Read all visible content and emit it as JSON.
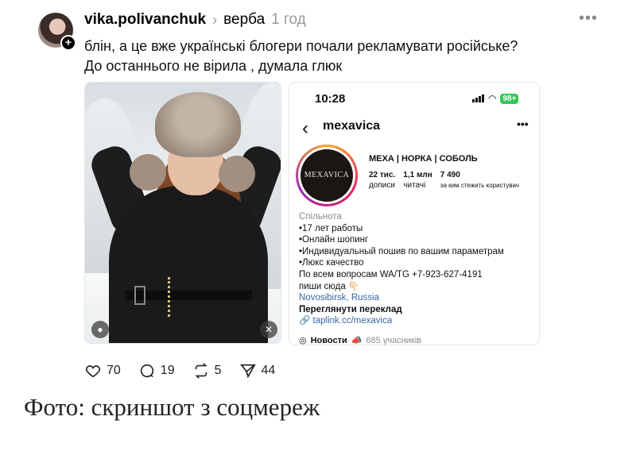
{
  "post": {
    "username": "vika.polivanchuk",
    "topic": "верба",
    "time": "1 год",
    "caption_line1": "блін, а це вже українські блогери почали рекламувати російське?",
    "caption_line2": "До останнього не вірила , думала глюк"
  },
  "screenshot": {
    "status_time": "10:28",
    "battery": "98+",
    "handle": "mexavica",
    "logo_text": "MEXAVICA",
    "profile_name": "МЕХА | НОРКА | СОБОЛЬ",
    "stats": [
      {
        "value": "22 тис.",
        "label": "дописи"
      },
      {
        "value": "1,1 млн",
        "label": "читачі"
      },
      {
        "value": "7 490",
        "label": "за ким стежить користувач"
      }
    ],
    "bio_category": "Спільнота",
    "bio_lines": [
      "•17 лет работы",
      "•Онлайн шопинг",
      "•Индивидуальный пошив по вашим параметрам",
      "•Люкс качество",
      "По всем вопросам WA/TG +7-923-627-4191",
      "пиши сюда 👇🏻"
    ],
    "location": "Novosibirsk, Russia",
    "translate": "Переглянути переклад",
    "link": "taplink.cc/mexavica",
    "channel_name": "Новости",
    "channel_members": "685 учасників"
  },
  "actions": {
    "likes": "70",
    "comments": "19",
    "reposts": "5",
    "shares": "44"
  },
  "photo_credit": "Фото: скриншот з соцмереж"
}
